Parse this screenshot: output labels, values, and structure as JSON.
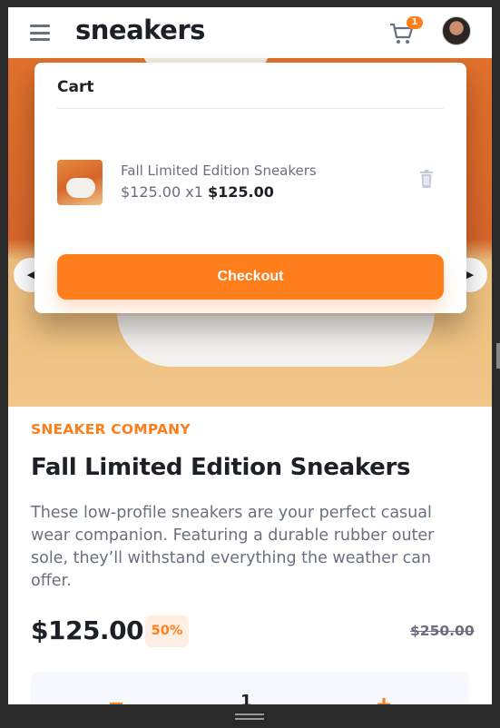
{
  "header": {
    "logo": "sneakers",
    "cart_badge": "1"
  },
  "carousel": {
    "prev_symbol": "◀",
    "next_symbol": "▶"
  },
  "cart": {
    "title": "Cart",
    "item": {
      "name": "Fall Limited Edition Sneakers",
      "unit_price": "$125.00 x1",
      "total": "$125.00"
    },
    "checkout_label": "Checkout"
  },
  "product": {
    "company": "SNEAKER COMPANY",
    "title": "Fall Limited Edition Sneakers",
    "description": "These low-profile sneakers are your perfect casual wear companion. Featuring a durable rubber outer sole, they’ll withstand everything the weather can offer.",
    "price": "$125.00",
    "discount": "50%",
    "original_price": "$250.00"
  },
  "quantity": {
    "minus": "−",
    "value": "1",
    "plus": "+"
  },
  "colors": {
    "accent": "#ff7e1b",
    "text_dark": "#1d2026",
    "text_gray": "#69707d",
    "pale_orange": "#ffeee2"
  }
}
